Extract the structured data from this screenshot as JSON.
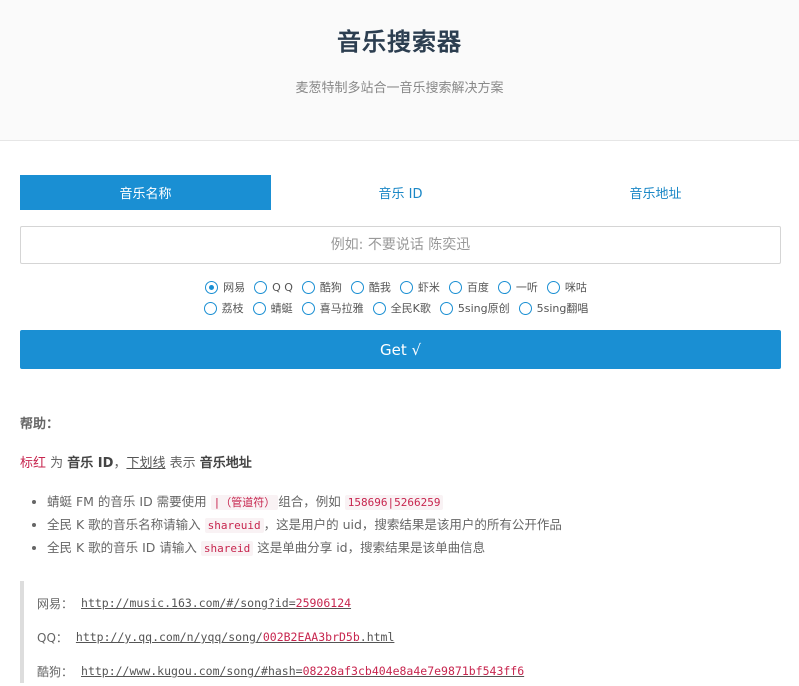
{
  "header": {
    "title": "音乐搜索器",
    "subtitle": "麦葱特制多站合一音乐搜索解决方案"
  },
  "tabs": [
    {
      "label": "音乐名称",
      "active": true
    },
    {
      "label": "音乐 ID",
      "active": false
    },
    {
      "label": "音乐地址",
      "active": false
    }
  ],
  "search": {
    "placeholder": "例如: 不要说话 陈奕迅",
    "value": ""
  },
  "sources_row1": [
    {
      "label": "网易",
      "checked": true
    },
    {
      "label": "Q Q",
      "checked": false
    },
    {
      "label": "酷狗",
      "checked": false
    },
    {
      "label": "酷我",
      "checked": false
    },
    {
      "label": "虾米",
      "checked": false
    },
    {
      "label": "百度",
      "checked": false
    },
    {
      "label": "一听",
      "checked": false
    },
    {
      "label": "咪咕",
      "checked": false
    }
  ],
  "sources_row2": [
    {
      "label": "荔枝",
      "checked": false
    },
    {
      "label": "蜻蜓",
      "checked": false
    },
    {
      "label": "喜马拉雅",
      "checked": false
    },
    {
      "label": "全民K歌",
      "checked": false
    },
    {
      "label": "5sing原创",
      "checked": false
    },
    {
      "label": "5sing翻唱",
      "checked": false
    }
  ],
  "get_button": "Get √",
  "help": {
    "title": "帮助：",
    "legend": {
      "red": "标红",
      "t1": " 为 ",
      "b1": "音乐 ID",
      "t2": "，",
      "u": "下划线",
      "t3": " 表示 ",
      "b2": "音乐地址"
    },
    "tips": [
      {
        "a": "蜻蜓 FM 的音乐 ID 需要使用 ",
        "code1": "|（管道符）",
        "b": "组合，例如 ",
        "code2": "158696|5266259",
        "c": ""
      },
      {
        "a": "全民 K 歌的音乐名称请输入 ",
        "code1": "shareuid",
        "b": "，这是用户的 uid，搜索结果是该用户的所有公开作品",
        "code2": "",
        "c": ""
      },
      {
        "a": "全民 K 歌的音乐 ID 请输入 ",
        "code1": "shareid",
        "b": " 这是单曲分享 id，搜索结果是该单曲信息",
        "code2": "",
        "c": ""
      }
    ]
  },
  "examples": [
    {
      "label": "网易：",
      "url_prefix": "http://music.163.com/#/song?id=",
      "id": "25906124"
    },
    {
      "label": "QQ：",
      "url_prefix": "http://y.qq.com/n/yqq/song/",
      "id": "002B2EAA3brD5b",
      "url_suffix": ".html"
    },
    {
      "label": "酷狗：",
      "url_prefix": "http://www.kugou.com/song/#hash=",
      "id": "08228af3cb404e8a4e7e9871bf543ff6"
    }
  ]
}
